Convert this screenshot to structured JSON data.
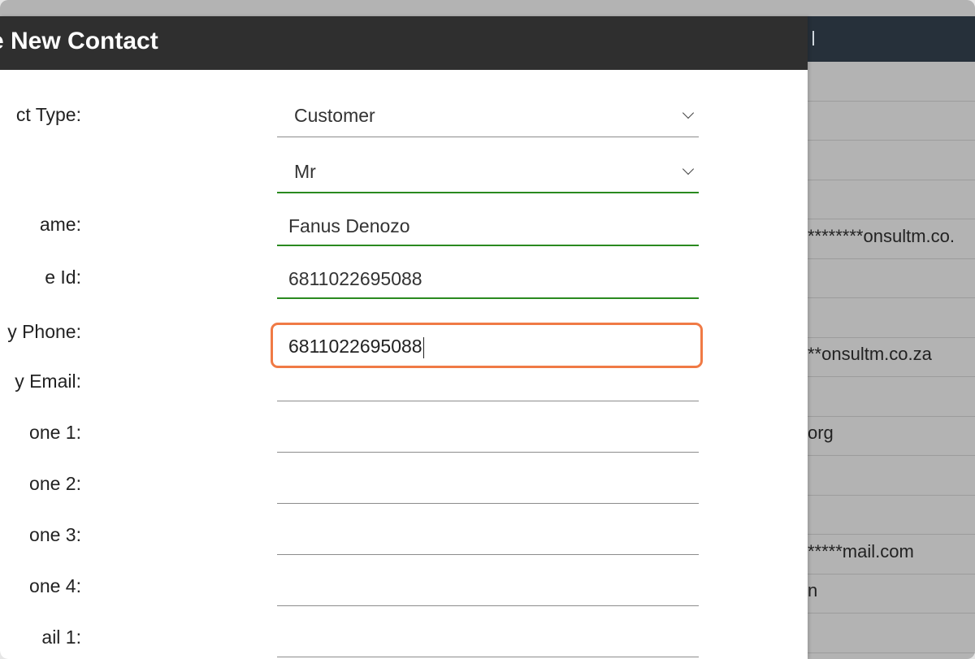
{
  "background_list": {
    "rows": [
      "",
      "",
      "",
      "",
      "********onsultm.co.",
      "",
      "",
      "**onsultm.co.za",
      "",
      "org",
      "",
      "",
      "*****mail.com",
      "n",
      ""
    ]
  },
  "modal": {
    "title": "te New Contact",
    "contact_type": {
      "label": "ct Type:",
      "value": "Customer"
    },
    "title_field": {
      "label": "",
      "value": "Mr"
    },
    "name": {
      "label": "ame:",
      "value": "Fanus Denozo"
    },
    "id": {
      "label": "e Id:",
      "value": "6811022695088"
    },
    "primary_phone": {
      "label": "y Phone:",
      "value": "6811022695088"
    },
    "primary_email": {
      "label": "y Email:",
      "value": ""
    },
    "phone1": {
      "label": "one 1:",
      "value": ""
    },
    "phone2": {
      "label": "one 2:",
      "value": ""
    },
    "phone3": {
      "label": "one 3:",
      "value": ""
    },
    "phone4": {
      "label": "one 4:",
      "value": ""
    },
    "email1": {
      "label": "ail 1:",
      "value": ""
    }
  },
  "colors": {
    "focus": "#f07a45",
    "valid": "#2a8a1f",
    "header": "#2f2f2f"
  }
}
